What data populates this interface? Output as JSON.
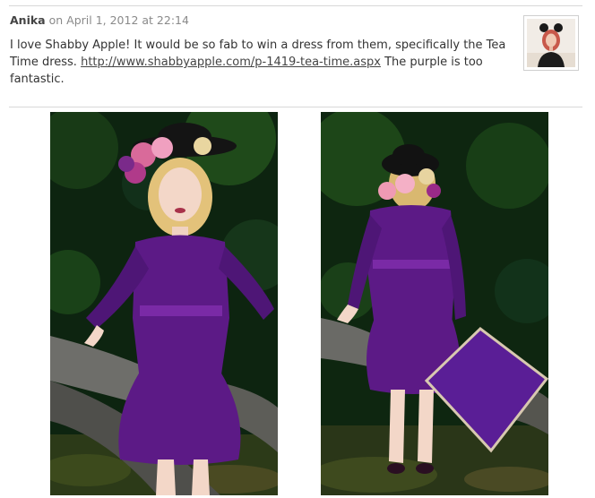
{
  "comment": {
    "author": "Anika",
    "date_prefix": "on",
    "date": "April 1, 2012 at 22:14",
    "body_before_link": "I love Shabby Apple! It would be so fab to win a dress from them, specifically the Tea Time dress.",
    "link_text": "http://www.shabbyapple.com/p-1419-tea-time.aspx",
    "body_after_link": "The purple is too fantastic."
  },
  "avatar": {
    "icon": "user-avatar-photo"
  },
  "photos": [
    {
      "icon": "model-front-view-photo"
    },
    {
      "icon": "model-back-view-photo"
    }
  ],
  "colors": {
    "dress_purple": "#5c1a86",
    "link": "#444444",
    "date_gray": "#8a8a8a",
    "foliage_dark": "#0d2410"
  }
}
